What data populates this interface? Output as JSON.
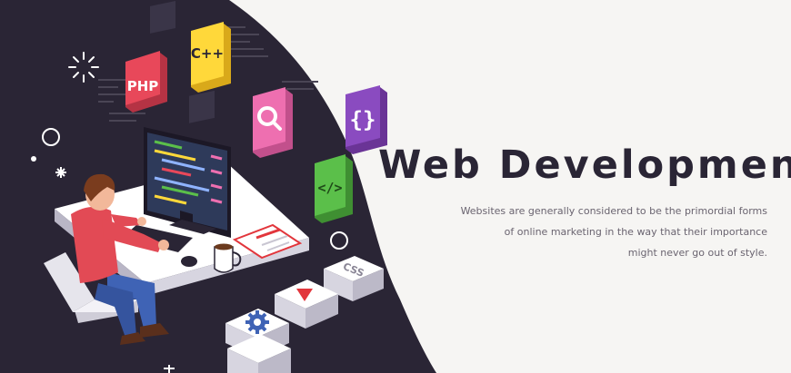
{
  "hero": {
    "headline": "Web Development",
    "description_lines": [
      "Websites are generally considered to be the primordial forms",
      "of online marketing in the way that their importance",
      "might never go out of style."
    ]
  },
  "illustration": {
    "badges": {
      "php": "PHP",
      "cpp": "C++",
      "braces": "{}",
      "code": "</>",
      "css": "CSS"
    },
    "icons": [
      "search-icon",
      "play-icon",
      "gear-icon",
      "sparkle-icon"
    ]
  },
  "colors": {
    "dark_background": "#2a2535",
    "page_background": "#f6f5f3",
    "php_badge": "#e8485a",
    "cpp_badge": "#ffd83a",
    "search_badge": "#ee6fb0",
    "braces_badge": "#8a4bc0",
    "code_badge": "#5bbf4a",
    "play_red": "#e2363c",
    "gear_blue": "#3f63b5",
    "shirt_red": "#e24a55"
  }
}
